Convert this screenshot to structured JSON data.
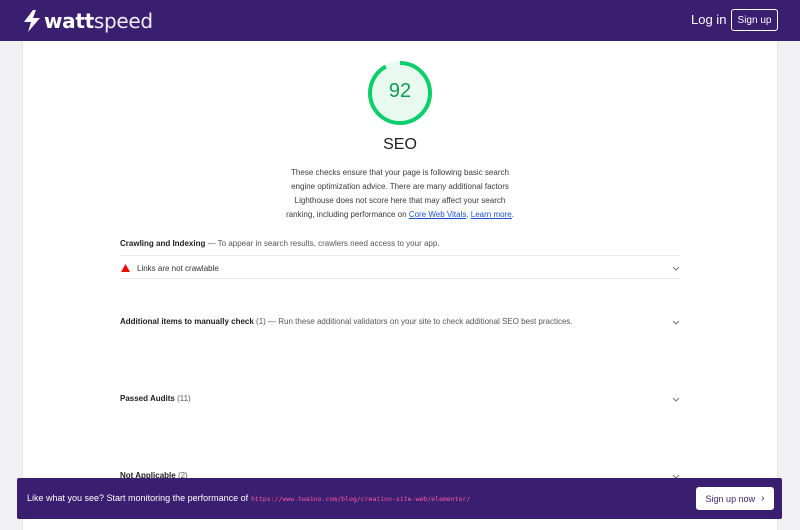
{
  "header": {
    "brand_bold": "watt",
    "brand_light": "speed",
    "login_label": "Log in",
    "signup_label": "Sign up"
  },
  "score": {
    "value": "92",
    "fraction": 0.92,
    "color": "#0cce6b",
    "category": "SEO"
  },
  "description": {
    "text": "These checks ensure that your page is following basic search engine optimization advice. There are many additional factors Lighthouse does not score here that may affect your search ranking, including performance on ",
    "link1": "Core Web Vitals",
    "link1_sep": ". ",
    "link2": "Learn more",
    "link2_end": "."
  },
  "sections": {
    "crawling": {
      "title": "Crawling and Indexing",
      "desc": " — To appear in search results, crawlers need access to your app.",
      "audits": [
        {
          "label": "Links are not crawlable",
          "status": "fail"
        }
      ]
    },
    "manual": {
      "title": "Additional items to manually check",
      "count": " (1)",
      "desc": " — Run these additional validators on your site to check additional SEO best practices."
    },
    "passed": {
      "title": "Passed Audits",
      "count": " (11)"
    },
    "not_applicable": {
      "title": "Not Applicable",
      "count": " (2)"
    }
  },
  "banner": {
    "text": "Like what you see? Start monitoring the performance of",
    "url": "https://www.twaino.com/blog/creation-site-web/elementor/",
    "button_label": "Sign up now",
    "button_arrow": "›"
  },
  "colors": {
    "brand": "#3a1e6f",
    "pass": "#0cce6b",
    "fail": "#eb0f00",
    "link": "#1a52c9",
    "url": "#ff58a3"
  }
}
